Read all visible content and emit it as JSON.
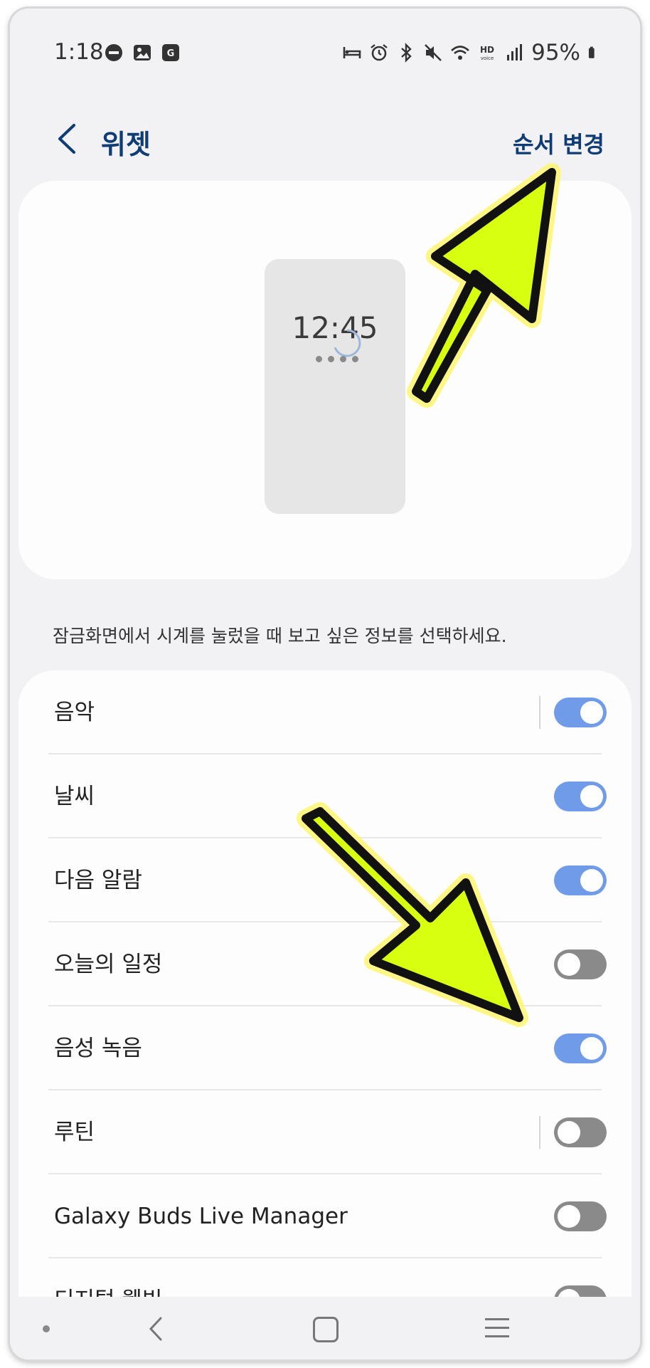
{
  "status_bar": {
    "time": "1:18",
    "battery": "95%",
    "left_icons": [
      "dnd-icon",
      "gallery-icon",
      "app-badge-icon"
    ],
    "right_icons": [
      "bed-icon",
      "alarm-icon",
      "bluetooth-icon",
      "mute-icon",
      "wifi-icon",
      "hd-voice-icon",
      "signal-icon",
      "battery-icon"
    ]
  },
  "header": {
    "title": "위젯",
    "action": "순서 변경"
  },
  "preview": {
    "clock": "12:45"
  },
  "description": "잠금화면에서 시계를 눌렀을 때 보고 싶은 정보를 선택하세요.",
  "widgets": [
    {
      "label": "음악",
      "on": true,
      "divider": true
    },
    {
      "label": "날씨",
      "on": true,
      "divider": false
    },
    {
      "label": "다음 알람",
      "on": true,
      "divider": false
    },
    {
      "label": "오늘의 일정",
      "on": false,
      "divider": false
    },
    {
      "label": "음성 녹음",
      "on": true,
      "divider": false
    },
    {
      "label": "루틴",
      "on": false,
      "divider": true
    },
    {
      "label": "Galaxy Buds Live Manager",
      "on": false,
      "divider": false
    },
    {
      "label": "디지털 웰빙",
      "on": false,
      "divider": false
    }
  ],
  "colors": {
    "accent": "#0f3c74",
    "toggle_on": "#6f9be8",
    "toggle_off": "#8a8a8a",
    "annotation_arrow": "#d8ff10"
  }
}
